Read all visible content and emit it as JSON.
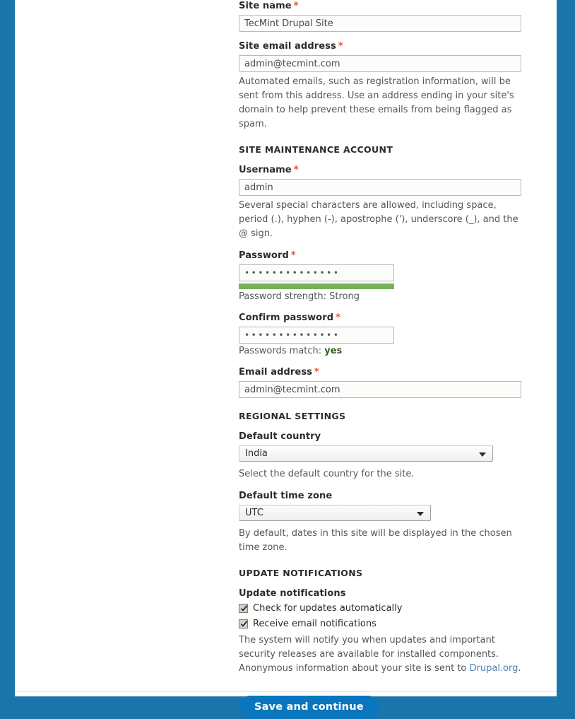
{
  "theme": {
    "page_blue": "#1b75ab",
    "button_blue": "#0a76bd",
    "strength_green": "#77b259",
    "link_blue": "#4884b8",
    "required_red": "#e74c3c"
  },
  "form": {
    "site_name": {
      "label": "Site name",
      "required_marker": "*",
      "value": "TecMint Drupal Site"
    },
    "site_email": {
      "label": "Site email address",
      "required_marker": "*",
      "value": "admin@tecmint.com",
      "description": "Automated emails, such as registration information, will be sent from this address. Use an address ending in your site's domain to help prevent these emails from being flagged as spam."
    },
    "maintenance_account": {
      "heading": "SITE MAINTENANCE ACCOUNT",
      "username": {
        "label": "Username",
        "required_marker": "*",
        "value": "admin",
        "description": "Several special characters are allowed, including space, period (.), hyphen (-), apostrophe ('), underscore (_), and the @ sign."
      },
      "password": {
        "label": "Password",
        "required_marker": "*",
        "value": "••••••••••••••",
        "strength_label": "Password strength:",
        "strength_value": "Strong",
        "strength_percent": 100
      },
      "confirm_password": {
        "label": "Confirm password",
        "required_marker": "*",
        "value": "••••••••••••••",
        "match_label": "Passwords match:",
        "match_value": "yes"
      },
      "email": {
        "label": "Email address",
        "required_marker": "*",
        "value": "admin@tecmint.com"
      }
    },
    "regional_settings": {
      "heading": "REGIONAL SETTINGS",
      "country": {
        "label": "Default country",
        "selected": "India",
        "description": "Select the default country for the site."
      },
      "timezone": {
        "label": "Default time zone",
        "selected": "UTC",
        "description": "By default, dates in this site will be displayed in the chosen time zone."
      }
    },
    "update_notifications": {
      "heading": "UPDATE NOTIFICATIONS",
      "group_label": "Update notifications",
      "checkbox_auto_updates": {
        "label": "Check for updates automatically",
        "checked": true
      },
      "checkbox_email_notifications": {
        "label": "Receive email notifications",
        "checked": true
      },
      "description_part1": "The system will notify you when updates and important security releases are available for installed components. Anonymous information about your site is sent to ",
      "description_link": "Drupal.org",
      "description_part2": "."
    },
    "submit": {
      "label": "Save and continue"
    }
  }
}
